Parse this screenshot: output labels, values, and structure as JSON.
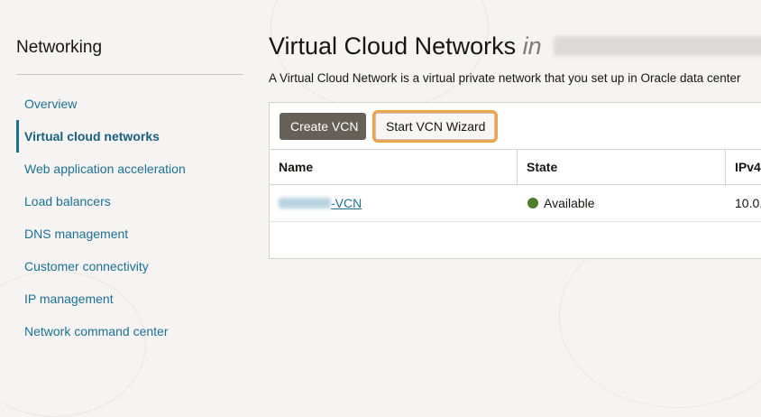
{
  "sidebar": {
    "title": "Networking",
    "items": [
      {
        "label": "Overview"
      },
      {
        "label": "Virtual cloud networks"
      },
      {
        "label": "Web application acceleration"
      },
      {
        "label": "Load balancers"
      },
      {
        "label": "DNS management"
      },
      {
        "label": "Customer connectivity"
      },
      {
        "label": "IP management"
      },
      {
        "label": "Network command center"
      }
    ]
  },
  "main": {
    "title": "Virtual Cloud Networks",
    "title_in": "in",
    "description": "A Virtual Cloud Network is a virtual private network that you set up in Oracle data center"
  },
  "toolbar": {
    "create_label": "Create VCN",
    "wizard_label": "Start VCN Wizard"
  },
  "table": {
    "columns": [
      "Name",
      "State",
      "IPv4"
    ],
    "rows": [
      {
        "name_suffix": "-VCN",
        "state": "Available",
        "ipv4": "10.0."
      }
    ]
  },
  "colors": {
    "accent": "#1e6f92",
    "focus_ring": "#f0a349",
    "status_available": "#4f7d2b",
    "primary_button": "#676058"
  }
}
